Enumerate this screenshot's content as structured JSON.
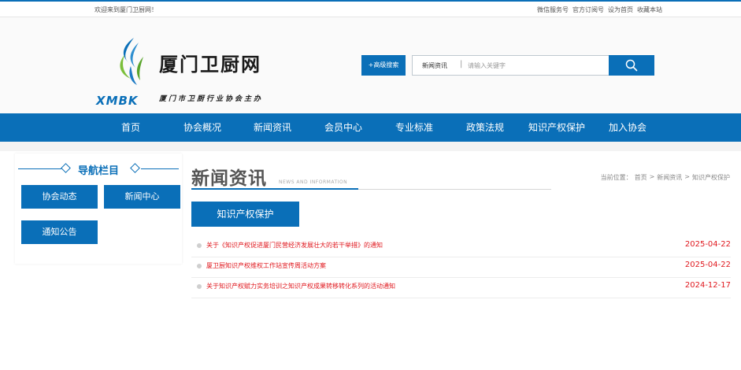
{
  "topbar": {
    "welcome": "欢迎来到厦门卫厨网！",
    "links": [
      "微信服务号",
      "官方订阅号",
      "设为首页",
      "收藏本站"
    ]
  },
  "logo": {
    "title": "厦门卫厨网",
    "subtitle": "厦门市卫厨行业协会主办",
    "abbr": "XMBK"
  },
  "search": {
    "advanced_label": "+高级搜索",
    "category": "新闻资讯",
    "separator": "|",
    "placeholder": "请输入关键字",
    "value": ""
  },
  "nav": {
    "items": [
      "首页",
      "协会概况",
      "新闻资讯",
      "会员中心",
      "专业标准",
      "政策法规",
      "知识产权保护",
      "加入协会"
    ]
  },
  "sidebar": {
    "title": "导航栏目",
    "items": [
      "协会动态",
      "新闻中心",
      "通知公告"
    ]
  },
  "main": {
    "title": "新闻资讯",
    "title_en": "NEWS AND INFORMATION",
    "breadcrumb": [
      "当前位置：",
      "首页",
      ">",
      "新闻资讯",
      ">",
      "知识产权保护"
    ],
    "category_button": "知识产权保护",
    "news": [
      {
        "title": "关于《知识产权促进厦门民营经济发展壮大的若干举措》的通知",
        "date": "2025-04-22"
      },
      {
        "title": "厦卫厨知识产权维权工作站宣传周活动方案",
        "date": "2025-04-22"
      },
      {
        "title": "关于知识产权赋力实务培训之知识产权成果转移转化系列的活动通知",
        "date": "2024-12-17"
      }
    ]
  },
  "colors": {
    "primary": "#0a6fb8",
    "news_red": "#e0191f"
  }
}
